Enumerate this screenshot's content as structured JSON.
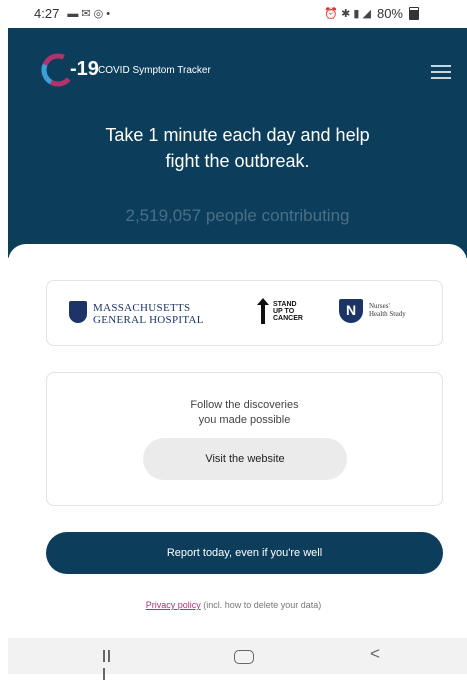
{
  "status_bar": {
    "time": "4:27",
    "battery": "80%"
  },
  "header": {
    "logo_number": "-19",
    "app_name": "COVID Symptom Tracker",
    "headline": "Take 1 minute each day and help fight the outbreak.",
    "contributors": "2,519,057 people contributing"
  },
  "partners": {
    "mgh_line1": "MASSACHUSETTS",
    "mgh_line2": "GENERAL HOSPITAL",
    "su2c_line1": "STAND",
    "su2c_line2": "UP TO",
    "su2c_line3": "CANCER",
    "nhs_line1": "Nurses'",
    "nhs_line2": "Health Study"
  },
  "discoveries": {
    "text": "Follow the discoveries\nyou made possible",
    "button_label": "Visit the website"
  },
  "report_button_label": "Report today, even if you're well",
  "privacy": {
    "link_label": "Privacy policy",
    "note": " (incl. how to delete your data)"
  },
  "colors": {
    "brand": "#0c3e5c",
    "logo_accent": "#b0336d",
    "link": "#b0336d"
  },
  "icons": [
    "menu-icon",
    "nav-recents-icon",
    "nav-home-icon",
    "nav-back-icon"
  ]
}
